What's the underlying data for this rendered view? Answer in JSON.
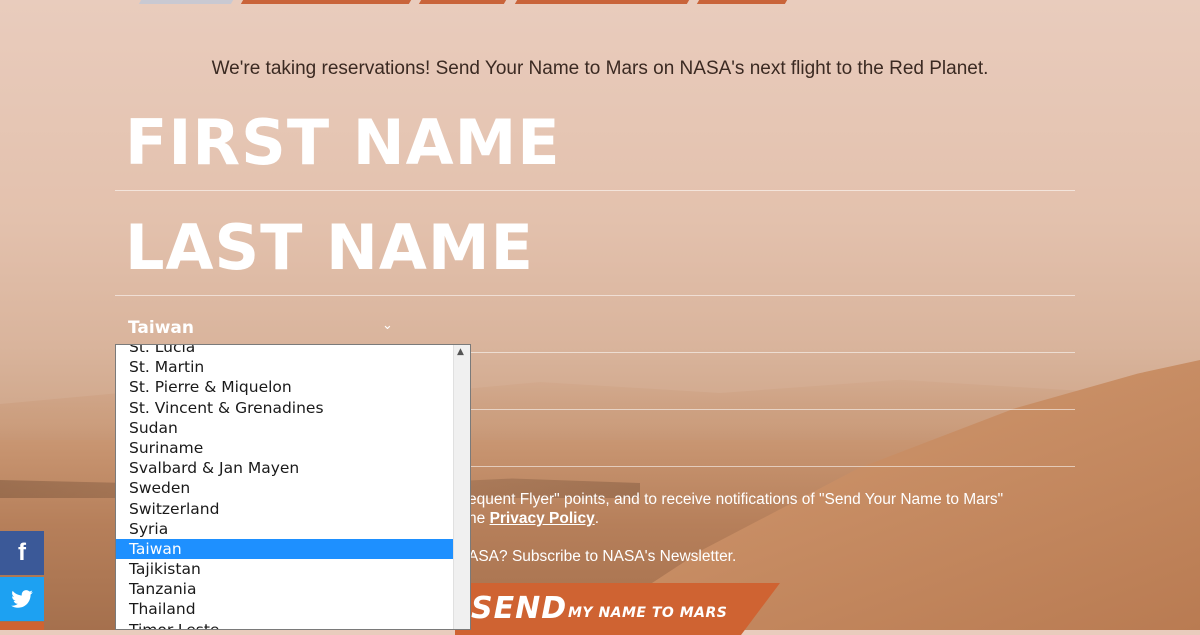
{
  "tagline": "We're taking reservations! Send Your Name to Mars on NASA's next flight to the Red Planet.",
  "form": {
    "first_name_label": "FIRST NAME",
    "last_name_label": "LAST NAME",
    "country_selected": "Taiwan",
    "consent_text": "equent Flyer\" points, and to receive notifications of \"Send Your Name to Mars\"",
    "consent_text_line2": "he",
    "privacy_link": "Privacy Policy",
    "period": ".",
    "newsletter_text": "ASA? Subscribe to NASA's Newsletter.",
    "send_big": "SEND",
    "send_small": "MY NAME TO MARS"
  },
  "dropdown": {
    "options": [
      "St. Lucia",
      "St. Martin",
      "St. Pierre & Miquelon",
      "St. Vincent & Grenadines",
      "Sudan",
      "Suriname",
      "Svalbard & Jan Mayen",
      "Sweden",
      "Switzerland",
      "Syria",
      "Taiwan",
      "Tajikistan",
      "Tanzania",
      "Thailand",
      "Timor-Leste"
    ],
    "selected_index": 10
  },
  "social": {
    "facebook_glyph": "f",
    "twitter_glyph": "t"
  },
  "colors": {
    "accent": "#cf6332",
    "selection": "#1e90ff",
    "facebook": "#3b5998",
    "twitter": "#1da1f2"
  }
}
